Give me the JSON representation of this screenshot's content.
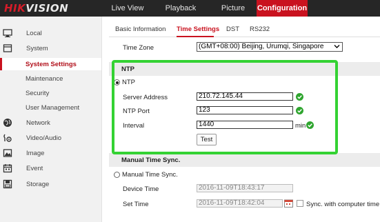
{
  "brand": {
    "logo_red": "HIK",
    "logo_white": "VISION"
  },
  "topnav": {
    "live_view": "Live View",
    "playback": "Playback",
    "picture": "Picture",
    "configuration": "Configuration"
  },
  "sidebar": {
    "items": [
      {
        "label": "Local",
        "icon": "monitor-icon"
      },
      {
        "label": "System",
        "icon": "system-icon"
      },
      {
        "label": "System Settings"
      },
      {
        "label": "Maintenance"
      },
      {
        "label": "Security"
      },
      {
        "label": "User Management"
      },
      {
        "label": "Network",
        "icon": "globe-icon"
      },
      {
        "label": "Video/Audio",
        "icon": "video-audio-icon"
      },
      {
        "label": "Image",
        "icon": "image-icon"
      },
      {
        "label": "Event",
        "icon": "event-icon"
      },
      {
        "label": "Storage",
        "icon": "storage-icon"
      }
    ]
  },
  "tabs": {
    "basic": "Basic Information",
    "time": "Time Settings",
    "dst": "DST",
    "rs232": "RS232"
  },
  "time_zone": {
    "label": "Time Zone",
    "value": "(GMT+08:00) Beijing, Urumqi, Singapore"
  },
  "ntp": {
    "section_title": "NTP",
    "radio_label": "NTP",
    "server_label": "Server Address",
    "server_value": "210.72.145.44",
    "port_label": "NTP Port",
    "port_value": "123",
    "interval_label": "Interval",
    "interval_value": "1440",
    "interval_unit": "min",
    "test_label": "Test"
  },
  "manual": {
    "section_title": "Manual Time Sync.",
    "radio_label": "Manual Time Sync.",
    "device_time_label": "Device Time",
    "device_time_value": "2016-11-09T18:43:17",
    "set_time_label": "Set Time",
    "set_time_value": "2016-11-09T18:42:04",
    "sync_label": "Sync. with computer time"
  },
  "colors": {
    "accent_red": "#c9121f",
    "highlight_green": "#34d233",
    "ok_green": "#2fa52f",
    "topbar": "#262626"
  }
}
